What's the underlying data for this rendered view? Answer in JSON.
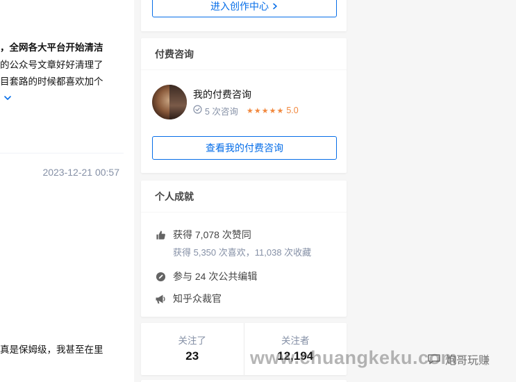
{
  "feed": {
    "excerpt_bold": "，全网各大平台开始清洁",
    "excerpt_line2": "的公众号文章好好清理了",
    "excerpt_line3": "目套路的时候都喜欢加个",
    "timestamp": "2023-12-21 00:57",
    "excerpt_line4": "真是保姆级，我甚至在里"
  },
  "creator": {
    "button_label": "进入创作中心"
  },
  "consult": {
    "heading": "付费咨询",
    "title": "我的付费咨询",
    "count_text": "5 次咨询",
    "stars": 5,
    "rating": "5.0",
    "button_label": "查看我的付费咨询"
  },
  "achievements": {
    "heading": "个人成就",
    "likes": "获得 7,078 次赞同",
    "likes_sub": "获得 5,350 次喜欢，11,038 次收藏",
    "edits": "参与 24 次公共编辑",
    "judge": "知乎众裁官"
  },
  "follow": {
    "following_label": "关注了",
    "following_count": "23",
    "followers_label": "关注者",
    "followers_count": "12,194"
  },
  "watermark": {
    "url": "www.chuangkeku.com",
    "badge": "炮哥玩赚"
  },
  "colors": {
    "accent": "#056de8",
    "rating": "#f1883e",
    "muted": "#8590a6"
  },
  "icons": [
    "chevron-down-icon",
    "chevron-right-icon",
    "check-circle-icon",
    "star-icon",
    "thumbs-up-icon",
    "pencil-icon",
    "megaphone-icon"
  ]
}
